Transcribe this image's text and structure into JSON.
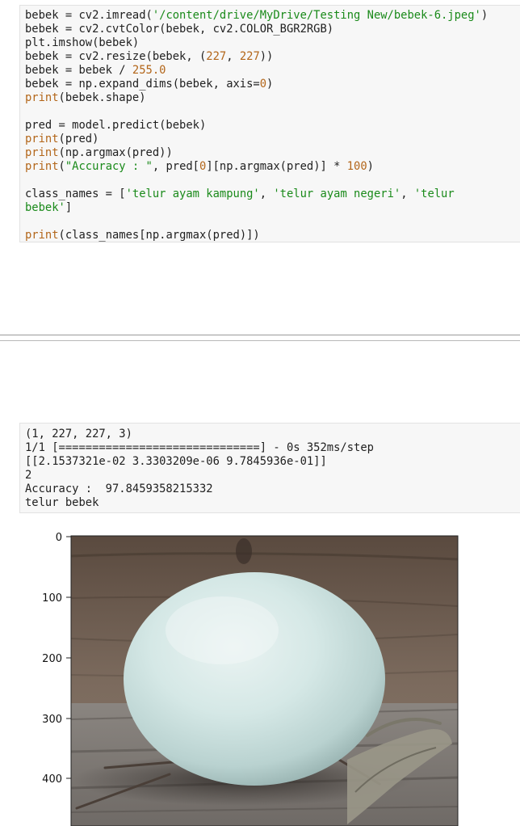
{
  "code_cell": {
    "lines": [
      [
        [
          "t",
          "bebek = cv2.imread("
        ],
        [
          "s",
          "'/content/drive/MyDrive/Testing New/bebek-6.jpeg'"
        ],
        [
          "t",
          ")"
        ]
      ],
      [
        [
          "t",
          "bebek = cv2.cvtColor(bebek, cv2.COLOR_BGR2RGB)"
        ]
      ],
      [
        [
          "t",
          "plt.imshow(bebek)"
        ]
      ],
      [
        [
          "t",
          "bebek = cv2.resize(bebek, ("
        ],
        [
          "n",
          "227"
        ],
        [
          "t",
          ", "
        ],
        [
          "n",
          "227"
        ],
        [
          "t",
          "))"
        ]
      ],
      [
        [
          "t",
          "bebek = bebek / "
        ],
        [
          "n",
          "255.0"
        ]
      ],
      [
        [
          "t",
          "bebek = np.expand_dims(bebek, axis="
        ],
        [
          "n",
          "0"
        ],
        [
          "t",
          ")"
        ]
      ],
      [
        [
          "b",
          "print"
        ],
        [
          "t",
          "(bebek.shape)"
        ]
      ],
      [
        [
          "t",
          ""
        ]
      ],
      [
        [
          "t",
          "pred = model.predict(bebek)"
        ]
      ],
      [
        [
          "b",
          "print"
        ],
        [
          "t",
          "(pred)"
        ]
      ],
      [
        [
          "b",
          "print"
        ],
        [
          "t",
          "(np.argmax(pred))"
        ]
      ],
      [
        [
          "b",
          "print"
        ],
        [
          "t",
          "("
        ],
        [
          "s",
          "\"Accuracy : \""
        ],
        [
          "t",
          ", pred["
        ],
        [
          "n",
          "0"
        ],
        [
          "t",
          "][np.argmax(pred)] * "
        ],
        [
          "n",
          "100"
        ],
        [
          "t",
          ")"
        ]
      ],
      [
        [
          "t",
          ""
        ]
      ],
      [
        [
          "t",
          "class_names = ["
        ],
        [
          "s",
          "'telur ayam kampung'"
        ],
        [
          "t",
          ", "
        ],
        [
          "s",
          "'telur ayam negeri'"
        ],
        [
          "t",
          ", "
        ],
        [
          "s",
          "'telur"
        ]
      ],
      [
        [
          "s",
          "bebek'"
        ],
        [
          "t",
          "]"
        ]
      ],
      [
        [
          "t",
          ""
        ]
      ],
      [
        [
          "b",
          "print"
        ],
        [
          "t",
          "(class_names[np.argmax(pred)])"
        ]
      ]
    ]
  },
  "output": {
    "line1": "(1, 227, 227, 3)",
    "line2": "1/1 [==============================] - 0s 352ms/step",
    "line3": "[[2.1537321e-02 3.3303209e-06 9.7845936e-01]]",
    "line4": "2",
    "line5": "Accuracy :  97.8459358215332",
    "line6": "telur bebek"
  },
  "plot": {
    "y_tick_labels": [
      "0",
      "100",
      "200",
      "300",
      "400"
    ],
    "image_subject": "pale blue-green duck egg on weathered wooden surface with dried leaves and twigs"
  }
}
